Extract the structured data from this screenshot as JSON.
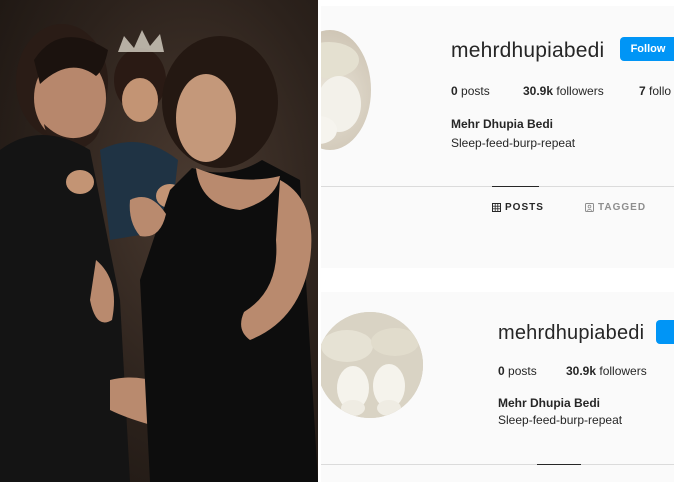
{
  "profile": {
    "username": "mehrdhupiabedi",
    "follow_label": "Follow",
    "posts_count": "0",
    "posts_label": "posts",
    "followers_count": "30.9k",
    "followers_label": "followers",
    "following_count": "7",
    "following_label": "follo",
    "full_name": "Mehr Dhupia Bedi",
    "bio": "Sleep-feed-burp-repeat"
  },
  "profile_bottom": {
    "username": "mehrdhupiabedi",
    "posts_count": "0",
    "posts_label": "posts",
    "followers_count": "30.9k",
    "followers_label": "followers",
    "full_name": "Mehr Dhupia Bedi",
    "bio": "Sleep-feed-burp-repeat"
  },
  "tabs": {
    "posts_label": "POSTS",
    "tagged_label": "TAGGED"
  },
  "colors": {
    "follow_button": "#0095f6",
    "text_primary": "#262626",
    "text_secondary": "#8e8e8e"
  },
  "icons": [
    "grid-icon",
    "tagged-icon"
  ]
}
